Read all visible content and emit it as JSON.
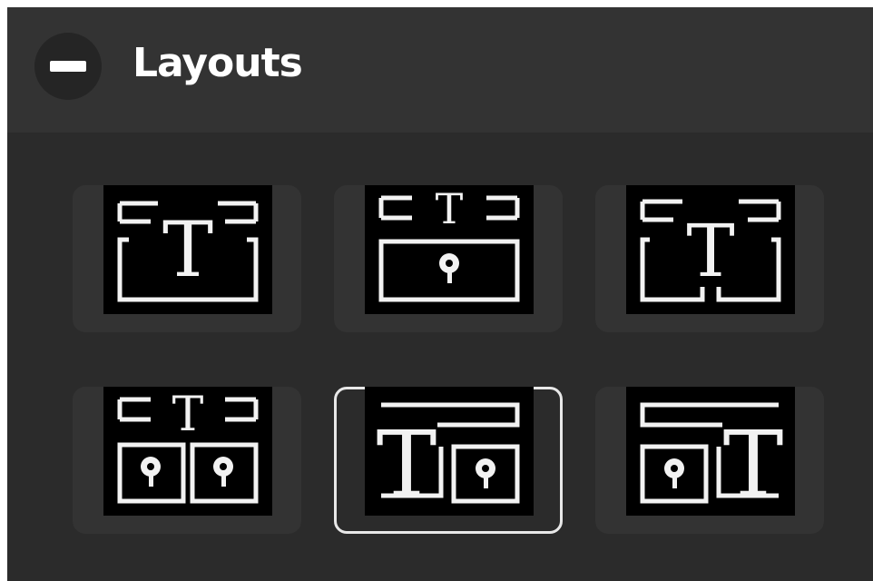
{
  "header": {
    "title": "Layouts",
    "collapse_icon": "minus-icon"
  },
  "layouts": [
    {
      "id": "title-only",
      "icon": "layout-title-only-icon",
      "selected": false,
      "title_glyph": "T"
    },
    {
      "id": "title-image",
      "icon": "layout-title-image-icon",
      "selected": false,
      "title_glyph": "T"
    },
    {
      "id": "title-two-column",
      "icon": "layout-title-two-column-icon",
      "selected": false,
      "title_glyph": "T"
    },
    {
      "id": "title-two-images",
      "icon": "layout-title-two-images-icon",
      "selected": false,
      "title_glyph": "T"
    },
    {
      "id": "text-left-image-right",
      "icon": "layout-text-left-image-right-icon",
      "selected": true,
      "title_glyph": "T"
    },
    {
      "id": "image-left-text-right",
      "icon": "layout-image-left-text-right-icon",
      "selected": false,
      "title_glyph": "T"
    }
  ],
  "colors": {
    "panel": "#2b2b2b",
    "header": "#333333",
    "tile": "#333333",
    "thumb": "#000000",
    "stroke": "#f2f2f2",
    "selected_border": "#e8e8e8"
  }
}
